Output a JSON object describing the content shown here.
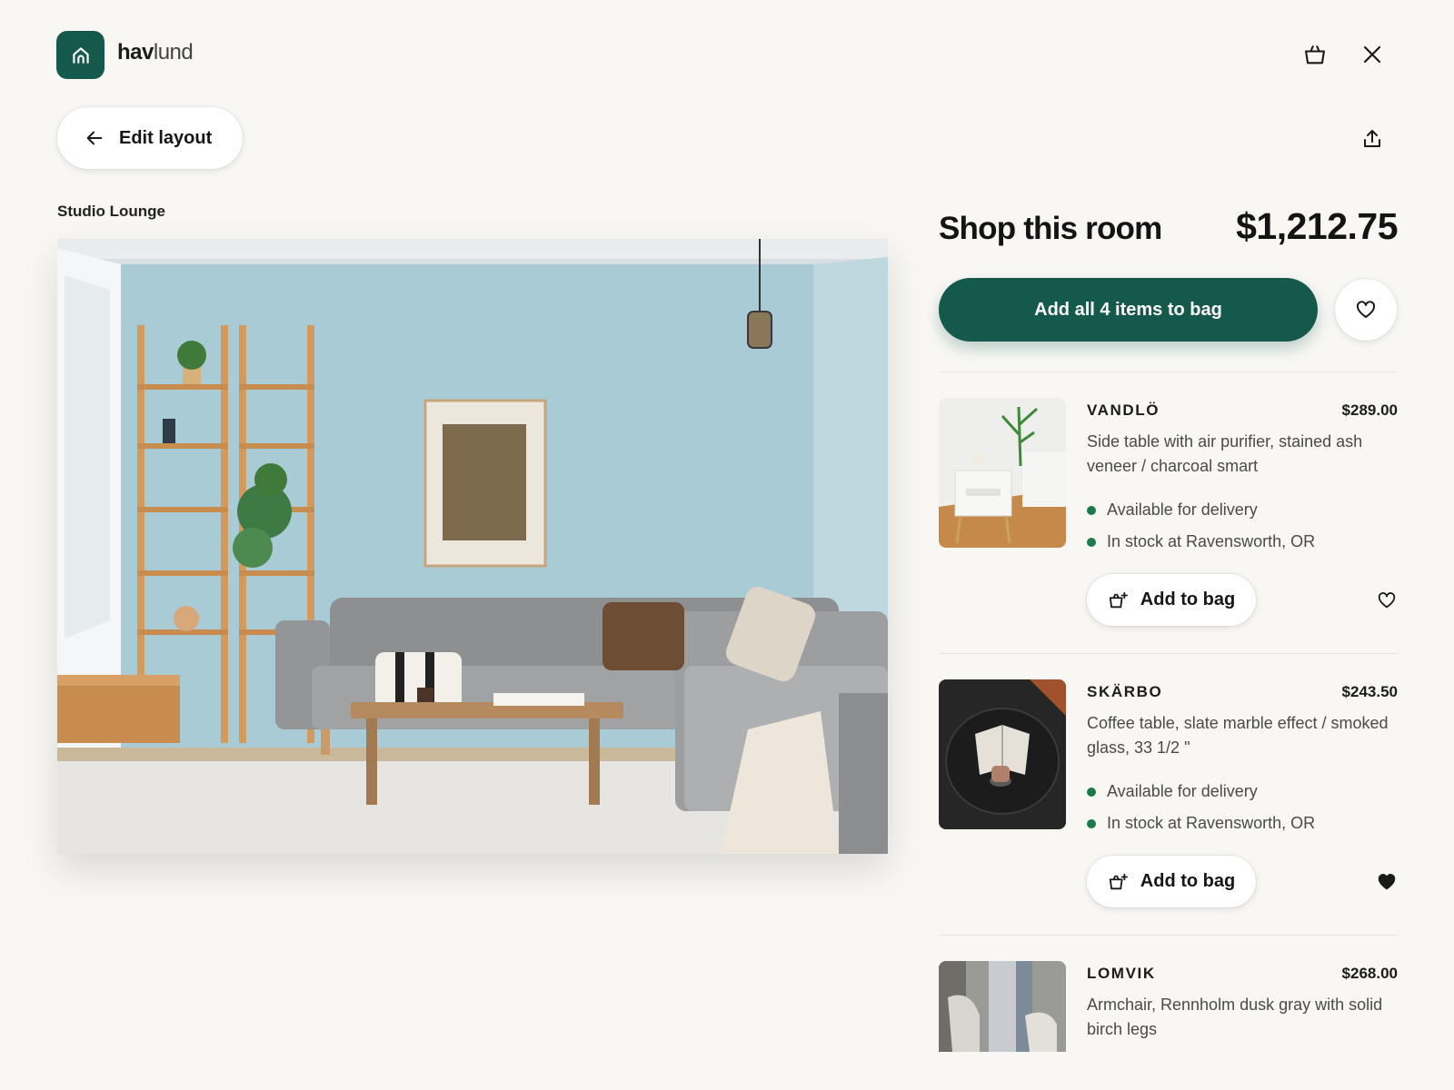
{
  "brand": {
    "bold": "hav",
    "rest": "lund",
    "accent": "#15594c"
  },
  "header": {
    "icons": {
      "bag": "shopping-bag-icon",
      "close": "close-icon",
      "share": "share-icon"
    }
  },
  "edit": {
    "label": "Edit layout",
    "icon": "arrow-left-icon"
  },
  "room": {
    "title": "Studio Lounge"
  },
  "shop": {
    "title": "Shop this room",
    "total": "$1,212.75",
    "add_all_label": "Add all 4 items to bag"
  },
  "products": [
    {
      "name": "VANDLÖ",
      "price": "$289.00",
      "description": "Side table with air purifier, stained ash veneer / charcoal smart",
      "availability": [
        "Available for delivery",
        "In stock at Ravensworth, OR"
      ],
      "button_label": "Add to bag",
      "favorited": false
    },
    {
      "name": "SKÄRBO",
      "price": "$243.50",
      "description": "Coffee table, slate marble effect / smoked glass, 33 1/2 \"",
      "availability": [
        "Available for delivery",
        "In stock at Ravensworth, OR"
      ],
      "button_label": "Add to bag",
      "favorited": true
    },
    {
      "name": "LOMVIK",
      "price": "$268.00",
      "description": "Armchair, Rennholm dusk gray with solid birch legs"
    }
  ],
  "colors": {
    "primary": "#15594c",
    "stock_dot": "#1c7a4c",
    "background": "#f8f7f4"
  }
}
